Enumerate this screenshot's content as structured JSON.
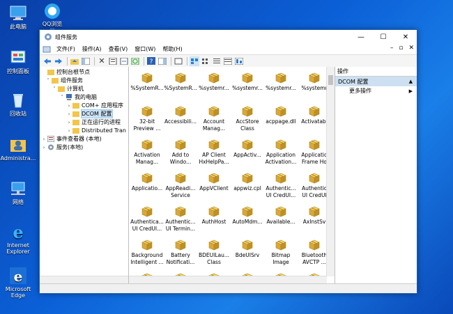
{
  "desktop": {
    "icons": [
      {
        "label": "此电脑",
        "icon": "computer-icon"
      },
      {
        "label": "控制面板",
        "icon": "control-panel-icon"
      },
      {
        "label": "回收站",
        "icon": "recycle-bin-icon"
      },
      {
        "label": "Administra...",
        "icon": "user-folder-icon"
      },
      {
        "label": "网络",
        "icon": "network-icon"
      },
      {
        "label": "Internet\nExplorer",
        "icon": "ie-icon"
      },
      {
        "label": "Microsoft\nEdge",
        "icon": "edge-icon"
      }
    ],
    "qq_label": "QQ浏览器"
  },
  "window": {
    "title": "组件服务",
    "menus": [
      "文件(F)",
      "操作(A)",
      "查看(V)",
      "窗口(W)",
      "帮助(H)"
    ]
  },
  "tree": [
    {
      "label": "控制台根节点",
      "level": 0,
      "exp": "",
      "icon": "folder"
    },
    {
      "label": "组件服务",
      "level": 1,
      "exp": "v",
      "icon": "folder"
    },
    {
      "label": "计算机",
      "level": 2,
      "exp": "v",
      "icon": "folder"
    },
    {
      "label": "我的电脑",
      "level": 3,
      "exp": "v",
      "icon": "computer"
    },
    {
      "label": "COM+ 应用程序",
      "level": 4,
      "exp": ">",
      "icon": "folder"
    },
    {
      "label": "DCOM 配置",
      "level": 4,
      "exp": ">",
      "icon": "folder",
      "selected": true
    },
    {
      "label": "正在运行的进程",
      "level": 4,
      "exp": ">",
      "icon": "folder"
    },
    {
      "label": "Distributed Tran",
      "level": 4,
      "exp": ">",
      "icon": "folder"
    },
    {
      "label": "事件查看器 (本地)",
      "level": 0,
      "exp": ">",
      "icon": "event"
    },
    {
      "label": "服务(本地)",
      "level": 0,
      "exp": ">",
      "icon": "gear"
    }
  ],
  "items": [
    [
      "%SystemR...",
      ""
    ],
    [
      "%SystemR...",
      ""
    ],
    [
      "%systemr...",
      ""
    ],
    [
      "%systemr...",
      ""
    ],
    [
      "%systemr...",
      ""
    ],
    [
      "%systemr",
      ""
    ],
    [
      "32-bit",
      "Preview ..."
    ],
    [
      "Accessibili...",
      ""
    ],
    [
      "Account",
      "Manag..."
    ],
    [
      "AccStore",
      "Class"
    ],
    [
      "acppage.dll",
      ""
    ],
    [
      "Activatabl",
      ""
    ],
    [
      "Activation",
      "Manag..."
    ],
    [
      "Add to",
      "Windo..."
    ],
    [
      "AP Client",
      "HxHelpPa..."
    ],
    [
      "AppActiv...",
      ""
    ],
    [
      "Application",
      "Activation..."
    ],
    [
      "Applicatio",
      "Frame Ho"
    ],
    [
      "Applicatio...",
      ""
    ],
    [
      "AppReadi...",
      "Service"
    ],
    [
      "AppVClient",
      ""
    ],
    [
      "appwiz.cpl",
      ""
    ],
    [
      "Authentic...",
      "UI CredUI..."
    ],
    [
      "Authentic",
      "UI CredUI"
    ],
    [
      "Authentica...",
      "UI CredUI..."
    ],
    [
      "Authentic...",
      "UI Termin..."
    ],
    [
      "AuthHost",
      ""
    ],
    [
      "AutoMdm...",
      ""
    ],
    [
      "Available...",
      ""
    ],
    [
      "AxInstSv",
      ""
    ],
    [
      "Background",
      "Intelligent ..."
    ],
    [
      "Battery",
      "Notificati..."
    ],
    [
      "BDEUILau...",
      "Class"
    ],
    [
      "BdeUISrv",
      ""
    ],
    [
      "Bitmap",
      "Image"
    ],
    [
      "Bluetooth",
      "AVCTP ..."
    ],
    [
      "",
      ""
    ],
    [
      "",
      ""
    ],
    [
      "",
      ""
    ],
    [
      "",
      ""
    ],
    [
      "",
      ""
    ],
    [
      "",
      ""
    ]
  ],
  "actions": {
    "header": "操作",
    "section": "DCOM 配置",
    "more": "更多操作"
  }
}
